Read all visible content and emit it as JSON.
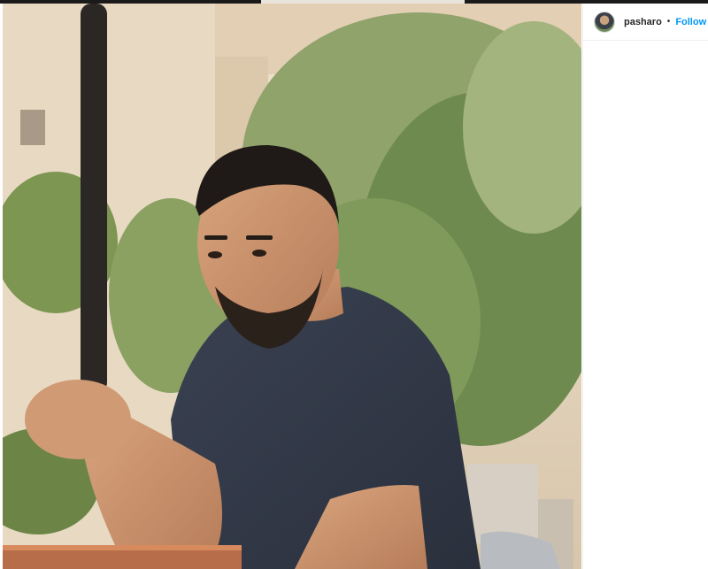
{
  "post": {
    "username": "pasharo",
    "separator": "•",
    "follow_label": "Follow"
  },
  "photo": {
    "alt_description": "Photo of a bearded man in a dark t-shirt sitting at a table in front of green plants",
    "icons": {
      "avatar": "profile-avatar"
    }
  },
  "colors": {
    "follow": "#0095f6",
    "username": "#262626",
    "border": "#efefef"
  }
}
